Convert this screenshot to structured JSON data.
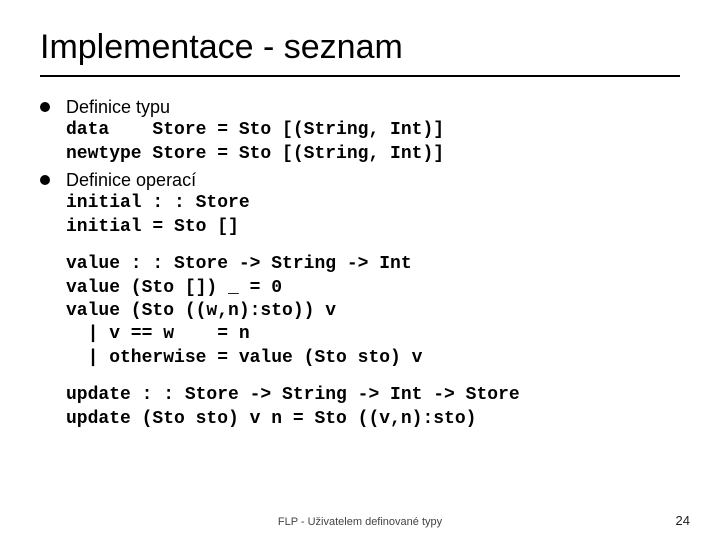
{
  "title": "Implementace - seznam",
  "items": [
    {
      "label": "Definice typu",
      "code": "data    Store = Sto [(String, Int)]\nnewtype Store = Sto [(String, Int)]"
    },
    {
      "label": "Definice operací",
      "code": "initial : : Store\ninitial = Sto []"
    }
  ],
  "blocks": [
    "value : : Store -> String -> Int\nvalue (Sto []) _ = 0\nvalue (Sto ((w,n):sto)) v\n  | v == w    = n\n  | otherwise = value (Sto sto) v",
    "update : : Store -> String -> Int -> Store\nupdate (Sto sto) v n = Sto ((v,n):sto)"
  ],
  "footer": "FLP - Uživatelem definované typy",
  "page": "24"
}
